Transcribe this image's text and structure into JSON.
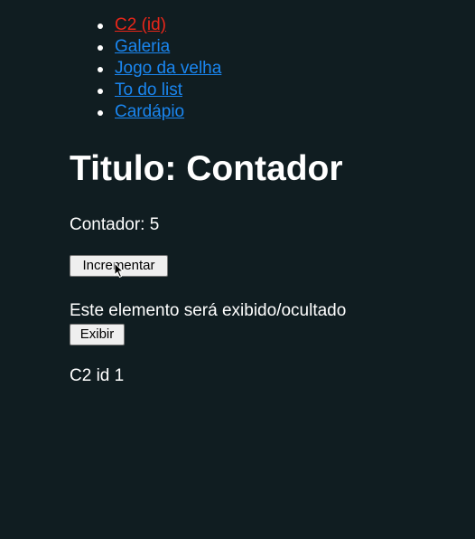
{
  "nav": {
    "items": [
      {
        "label": "C2 (id)"
      },
      {
        "label": "Galeria"
      },
      {
        "label": "Jogo da velha"
      },
      {
        "label": "To do list"
      },
      {
        "label": "Cardápio"
      }
    ]
  },
  "main": {
    "title": "Titulo: Contador",
    "counter": {
      "label": "Contador:",
      "value": "5"
    },
    "increment_button": "Incrementar",
    "toggle_text": "Este elemento será exibido/ocultado",
    "show_button": "Exibir",
    "c2_text": "C2 id 1"
  },
  "colors": {
    "background": "#101d21",
    "link": "#1a86f0",
    "active_link": "#e8261a",
    "text": "#ffffff"
  },
  "icons": {
    "cursor": "mouse-pointer-icon"
  }
}
